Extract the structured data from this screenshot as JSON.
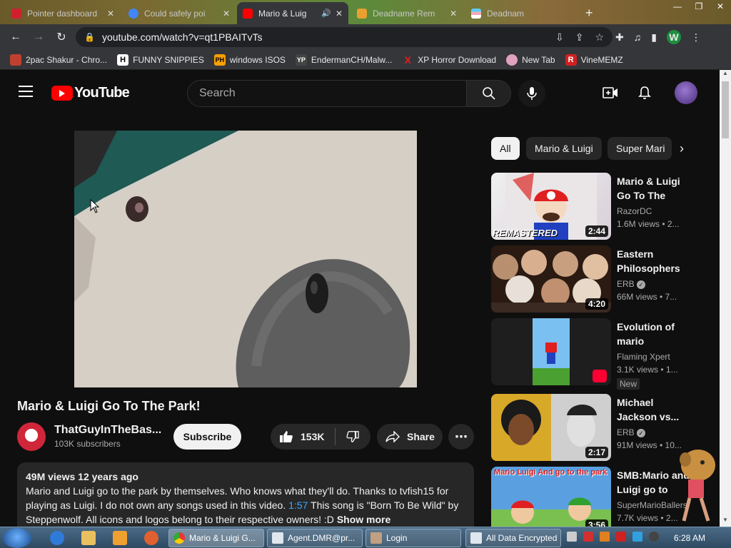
{
  "browser": {
    "tabs": [
      {
        "title": "Pointer dashboard",
        "favicon_color": "#d02030",
        "active": false
      },
      {
        "title": "Could safely poi",
        "favicon_color": "#4285f4",
        "active": false
      },
      {
        "title": "Mario & Luig",
        "favicon_color": "#ff0000",
        "active": true
      },
      {
        "title": "Deadname Rem",
        "favicon_color": "#e8a030",
        "active": false
      },
      {
        "title": "Deadnam",
        "favicon_color": "#f0a0c0",
        "active": false
      }
    ],
    "url": "youtube.com/watch?v=qt1PBAITvTs",
    "profile_initial": "W",
    "bookmarks": [
      {
        "label": "2pac Shakur - Chro...",
        "icon": "chrome-store-icon",
        "icon_text": "",
        "icon_color": "#c04030"
      },
      {
        "label": "FUNNY SNIPPIES",
        "icon": "h-icon",
        "icon_text": "H",
        "icon_color": "#ffffff"
      },
      {
        "label": "windows ISOS",
        "icon": "ph-icon",
        "icon_text": "PH",
        "icon_color": "#f7a000"
      },
      {
        "label": "EndermanCH/Malw...",
        "icon": "yp-icon",
        "icon_text": "YP",
        "icon_color": "#444444"
      },
      {
        "label": "XP Horror Download",
        "icon": "x-icon",
        "icon_text": "X",
        "icon_color": "#e02020"
      },
      {
        "label": "New Tab",
        "icon": "newtab-icon",
        "icon_text": "",
        "icon_color": "#e0a0c0"
      },
      {
        "label": "VineMEMZ",
        "icon": "r-icon",
        "icon_text": "R",
        "icon_color": "#d02020"
      }
    ]
  },
  "youtube": {
    "logo_text": "YouTube",
    "search_placeholder": "Search",
    "video": {
      "title": "Mario & Luigi Go To The Park!",
      "channel": "ThatGuyInTheBas...",
      "subscribers": "103K subscribers",
      "subscribe_label": "Subscribe",
      "likes": "153K",
      "share_label": "Share",
      "views_age": "49M views  12 years ago",
      "desc_1": "Mario and Luigi go to the park by themselves. Who knows what they'll do. Thanks to tvfish15 for playing as Luigi. I do not own any songs used in this video. ",
      "desc_timestamp": "1:57",
      "desc_2": " This song is \"Born To Be Wild\" by Steppenwolf. All icons and logos belong to their respective owners! :D ",
      "show_more": "Show more"
    },
    "chips": [
      "All",
      "Mario & Luigi",
      "Super Mari"
    ],
    "recommendations": [
      {
        "title": "Mario & Luigi Go To The Par...",
        "channel": "RazorDC",
        "views": "1.6M views  •  2...",
        "duration": "2:44",
        "verified": false,
        "thumb_text": "REMASTERED",
        "badge": ""
      },
      {
        "title": "Eastern Philosophers ...",
        "channel": "ERB",
        "views": "66M views  •  7...",
        "duration": "4:20",
        "verified": true,
        "thumb_text": "",
        "badge": ""
      },
      {
        "title": "Evolution of mario",
        "channel": "Flaming Xpert",
        "views": "3.1K views  •  1...",
        "duration": "",
        "verified": false,
        "thumb_text": "",
        "badge": "New"
      },
      {
        "title": "Michael Jackson vs...",
        "channel": "ERB",
        "views": "91M views  •  10...",
        "duration": "2:17",
        "verified": true,
        "thumb_text": "",
        "badge": ""
      },
      {
        "title": "SMB:Mario and Luigi go to the...",
        "channel": "SuperMarioBallers",
        "views": "7.7K views  •  2...",
        "duration": "3:56",
        "verified": false,
        "thumb_text": "Mario Luigi And go to the park",
        "badge": ""
      }
    ]
  },
  "taskbar": {
    "buttons": [
      "Mario & Luigi G...",
      "Agent.DMR@pr...",
      "Login",
      "All Data Encrypted"
    ],
    "clock": "6:28 AM"
  }
}
